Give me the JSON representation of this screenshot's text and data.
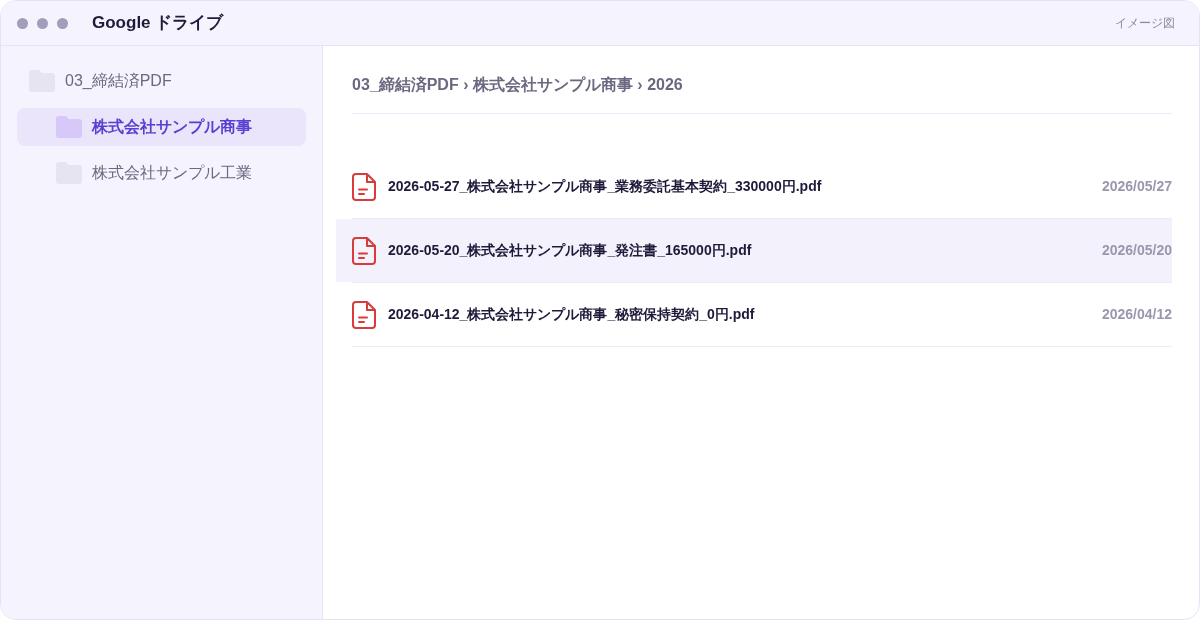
{
  "window": {
    "title": "Google ドライブ",
    "badge": "イメージ図"
  },
  "sidebar": {
    "tree": [
      {
        "label": "03_締結済PDF",
        "selected": false,
        "children": [
          {
            "label": "株式会社サンプル商事",
            "selected": true
          },
          {
            "label": "株式会社サンプル工業",
            "selected": false
          }
        ]
      }
    ]
  },
  "breadcrumb": "03_締結済PDF › 株式会社サンプル商事 › 2026",
  "files": [
    {
      "name": "2026-05-27_株式会社サンプル商事_業務委託基本契約_330000円.pdf",
      "date": "2026/05/27",
      "selected": false
    },
    {
      "name": "2026-05-20_株式会社サンプル商事_発注書_165000円.pdf",
      "date": "2026/05/20",
      "selected": true
    },
    {
      "name": "2026-04-12_株式会社サンプル商事_秘密保持契約_0円.pdf",
      "date": "2026/04/12",
      "selected": false
    }
  ]
}
